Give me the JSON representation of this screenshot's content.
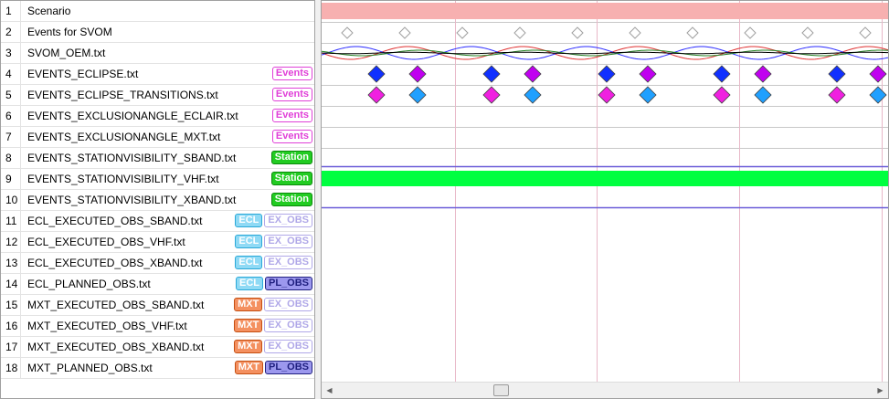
{
  "rows": [
    {
      "num": "1",
      "label": "Scenario",
      "badges": []
    },
    {
      "num": "2",
      "label": "Events for SVOM",
      "badges": []
    },
    {
      "num": "3",
      "label": "SVOM_OEM.txt",
      "badges": []
    },
    {
      "num": "4",
      "label": "EVENTS_ECLIPSE.txt",
      "badges": [
        {
          "text": "Events",
          "style": "events"
        }
      ]
    },
    {
      "num": "5",
      "label": "EVENTS_ECLIPSE_TRANSITIONS.txt",
      "badges": [
        {
          "text": "Events",
          "style": "events"
        }
      ]
    },
    {
      "num": "6",
      "label": "EVENTS_EXCLUSIONANGLE_ECLAIR.txt",
      "badges": [
        {
          "text": "Events",
          "style": "events"
        }
      ]
    },
    {
      "num": "7",
      "label": "EVENTS_EXCLUSIONANGLE_MXT.txt",
      "badges": [
        {
          "text": "Events",
          "style": "events"
        }
      ]
    },
    {
      "num": "8",
      "label": "EVENTS_STATIONVISIBILITY_SBAND.txt",
      "badges": [
        {
          "text": "Station",
          "style": "station"
        }
      ]
    },
    {
      "num": "9",
      "label": "EVENTS_STATIONVISIBILITY_VHF.txt",
      "badges": [
        {
          "text": "Station",
          "style": "station"
        }
      ]
    },
    {
      "num": "10",
      "label": "EVENTS_STATIONVISIBILITY_XBAND.txt",
      "badges": [
        {
          "text": "Station",
          "style": "station"
        }
      ]
    },
    {
      "num": "11",
      "label": "ECL_EXECUTED_OBS_SBAND.txt",
      "badges": [
        {
          "text": "ECL",
          "style": "ecl"
        },
        {
          "text": "EX_OBS",
          "style": "exobs"
        }
      ]
    },
    {
      "num": "12",
      "label": "ECL_EXECUTED_OBS_VHF.txt",
      "badges": [
        {
          "text": "ECL",
          "style": "ecl"
        },
        {
          "text": "EX_OBS",
          "style": "exobs"
        }
      ]
    },
    {
      "num": "13",
      "label": "ECL_EXECUTED_OBS_XBAND.txt",
      "badges": [
        {
          "text": "ECL",
          "style": "ecl"
        },
        {
          "text": "EX_OBS",
          "style": "exobs"
        }
      ]
    },
    {
      "num": "14",
      "label": "ECL_PLANNED_OBS.txt",
      "badges": [
        {
          "text": "ECL",
          "style": "ecl"
        },
        {
          "text": "PL_OBS",
          "style": "plobs"
        }
      ]
    },
    {
      "num": "15",
      "label": "MXT_EXECUTED_OBS_SBAND.txt",
      "badges": [
        {
          "text": "MXT",
          "style": "mxt"
        },
        {
          "text": "EX_OBS",
          "style": "exobs"
        }
      ]
    },
    {
      "num": "16",
      "label": "MXT_EXECUTED_OBS_VHF.txt",
      "badges": [
        {
          "text": "MXT",
          "style": "mxt"
        },
        {
          "text": "EX_OBS",
          "style": "exobs"
        }
      ]
    },
    {
      "num": "17",
      "label": "MXT_EXECUTED_OBS_XBAND.txt",
      "badges": [
        {
          "text": "MXT",
          "style": "mxt"
        },
        {
          "text": "EX_OBS",
          "style": "exobs"
        }
      ]
    },
    {
      "num": "18",
      "label": "MXT_PLANNED_OBS.txt",
      "badges": [
        {
          "text": "MXT",
          "style": "mxt"
        },
        {
          "text": "PL_OBS",
          "style": "plobs"
        }
      ]
    }
  ],
  "timeline": {
    "scenario_color": "#f7b0b0",
    "station_color": "#00ff40",
    "station_line_color": "#6a5cd8",
    "eclipse_colors": [
      "#1030ff",
      "#c000f0"
    ],
    "transition_colors": [
      "#f020e0",
      "#20a0ff"
    ],
    "orbit_colors": [
      "#e03030",
      "#2a2aff",
      "#208020",
      "#000000"
    ],
    "event_icon": "hollow-diamond-icon",
    "eclipse_icon": "filled-diamond-icon"
  },
  "scrollbar": {
    "left_icon": "arrow-left-icon",
    "right_icon": "arrow-right-icon",
    "position": 0.3
  }
}
